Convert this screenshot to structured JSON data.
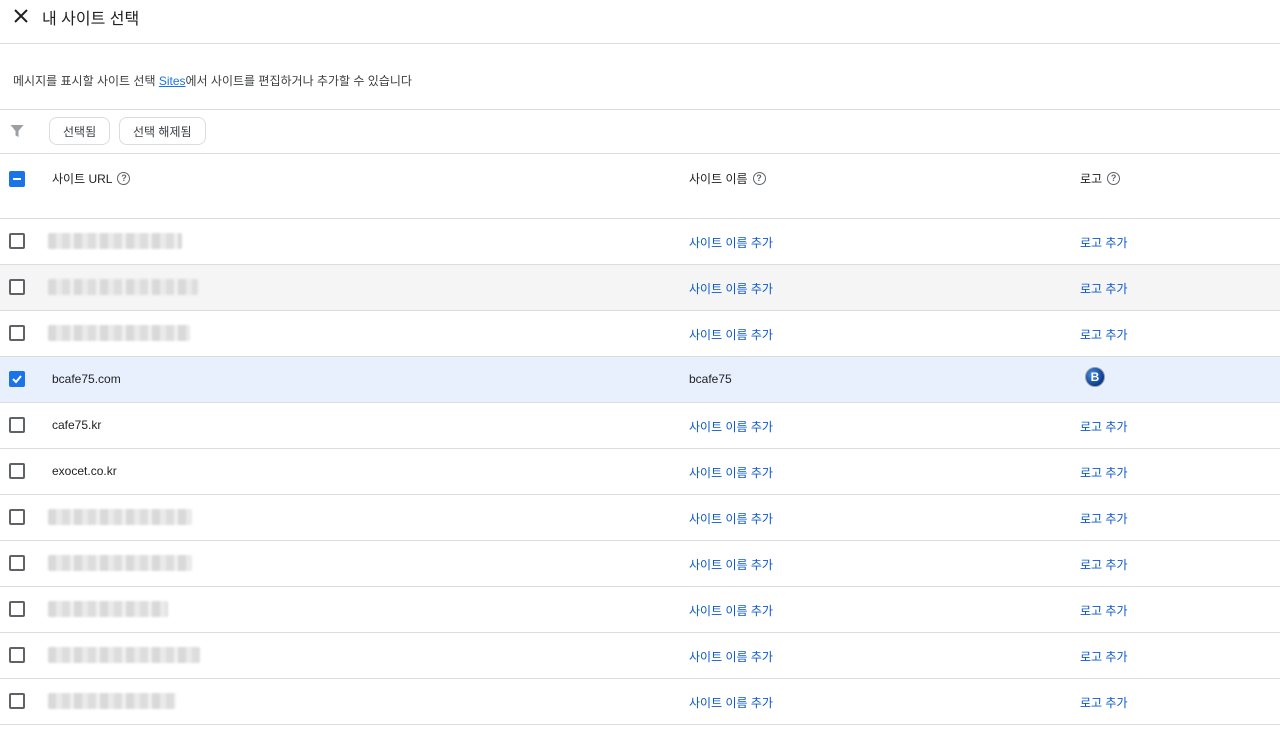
{
  "header": {
    "title": "내 사이트 선택"
  },
  "description": {
    "before": "메시지를 표시할 사이트 선택 ",
    "link": "Sites",
    "after": "에서 사이트를 편집하거나 추가할 수 있습니다"
  },
  "filter": {
    "chips": [
      "선택됨",
      "선택 해제됨"
    ]
  },
  "columns": {
    "url": "사이트 URL",
    "name": "사이트 이름",
    "logo": "로고",
    "help": "?"
  },
  "rows": [
    {
      "url": "",
      "name": "",
      "logo": "",
      "checked": false
    },
    {
      "url": "",
      "name": "",
      "logo": "",
      "checked": false
    },
    {
      "url": "",
      "name": "",
      "logo": "",
      "checked": false
    },
    {
      "url": "bcafe75.com",
      "name": "bcafe75",
      "logo": "B",
      "checked": true
    },
    {
      "url": "cafe75.kr",
      "name": "",
      "logo": "",
      "checked": false
    },
    {
      "url": "exocet.co.kr",
      "name": "",
      "logo": "",
      "checked": false
    },
    {
      "url": "",
      "name": "",
      "logo": "",
      "checked": false
    },
    {
      "url": "",
      "name": "",
      "logo": "",
      "checked": false
    },
    {
      "url": "",
      "name": "",
      "logo": "",
      "checked": false
    },
    {
      "url": "",
      "name": "",
      "logo": "",
      "checked": false
    },
    {
      "url": "",
      "name": "",
      "logo": "",
      "checked": false
    }
  ],
  "actions": {
    "add_name": "사이트 이름 추가",
    "add_logo": "로고 추가"
  },
  "colors": {
    "accent": "#1a73e8",
    "link": "#0b57d0",
    "selected_row": "#e8f0fe"
  }
}
